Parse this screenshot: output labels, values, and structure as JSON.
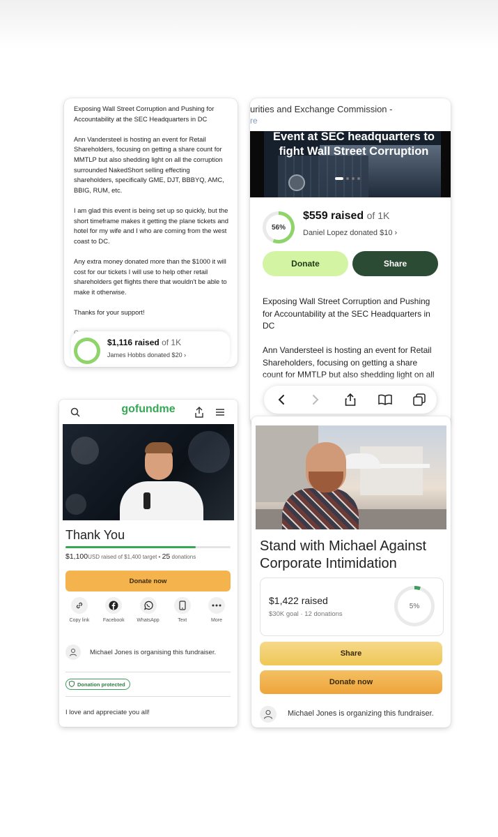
{
  "card1": {
    "paragraphs": [
      "Exposing Wall Street Corruption and Pushing for Accountability at the SEC Headquarters in DC",
      "Ann Vandersteel is hosting an event for Retail Shareholders, focusing on getting a share count for MMTLP but also shedding light on all the corruption surrounded NakedShort selling effecting shareholders, specifically GME, DJT, BBBYQ, AMC, BBIG, RUM, etc.",
      "I am glad this event is being set up so quickly, but the short timeframe makes it getting the plane tickets and hotel for my wife and I who are coming from the west coast to DC.",
      "Any extra money donated more than the $1000 it will cost for our tickets I will use to help other retail shareholders get flights there that wouldn't be able to make it otherwise.",
      "Thanks for your support!"
    ],
    "cut_text": "Cc",
    "raised": "$1,116 raised",
    "of_goal": "of 1K",
    "donor": "James Hobbs donated $20",
    "progress": 1.0,
    "accent": "#8fd36b"
  },
  "card2": {
    "url_line1": "urities and Exchange Commission -",
    "url_line2": "re",
    "hero_title": "Event at SEC headquarters to fight Wall Street Corruption",
    "percent": "56%",
    "progress": 0.56,
    "raised": "$559 raised",
    "of_goal": "of 1K",
    "donor": "Daniel Lopez donated $10",
    "donate_label": "Donate",
    "share_label": "Share",
    "desc": [
      "Exposing Wall Street Corruption and Pushing for Accountability at the SEC Headquarters in DC",
      "Ann Vandersteel is hosting an event for Retail Shareholders, focusing on getting a share count for MMTLP but also shedding light on all"
    ],
    "toolbar_icons": [
      "back-icon",
      "forward-icon",
      "share-icon",
      "bookmarks-icon",
      "tabs-icon"
    ],
    "accent": "#8fd36b"
  },
  "card3": {
    "logo": "gofundme",
    "title": "Thank You",
    "progress": 0.79,
    "amount": "$1,100",
    "stats_mid": "USD raised of $1,400 target",
    "sep": "•",
    "donations_count": "25",
    "donations_label": "donations",
    "donate_label": "Donate now",
    "share_options": [
      {
        "label": "Copy link",
        "icon": "link-icon"
      },
      {
        "label": "Facebook",
        "icon": "facebook-icon"
      },
      {
        "label": "WhatsApp",
        "icon": "whatsapp-icon"
      },
      {
        "label": "Text",
        "icon": "phone-icon"
      },
      {
        "label": "More",
        "icon": "more-icon"
      }
    ],
    "organizer": "Michael Jones is organising this fundraiser.",
    "protected": "Donation protected",
    "message": "I love and appreciate you all!",
    "accent": "#34a853"
  },
  "card4": {
    "title": "Stand with Michael Against Corporate Intimidation",
    "raised": "$1,422 raised",
    "goal": "$30K goal",
    "dot": "·",
    "donations": "12 donations",
    "percent": "5%",
    "progress": 0.05,
    "share_label": "Share",
    "donate_label": "Donate now",
    "organizer": "Michael Jones is organizing this fundraiser.",
    "accent": "#3f9d5c"
  }
}
